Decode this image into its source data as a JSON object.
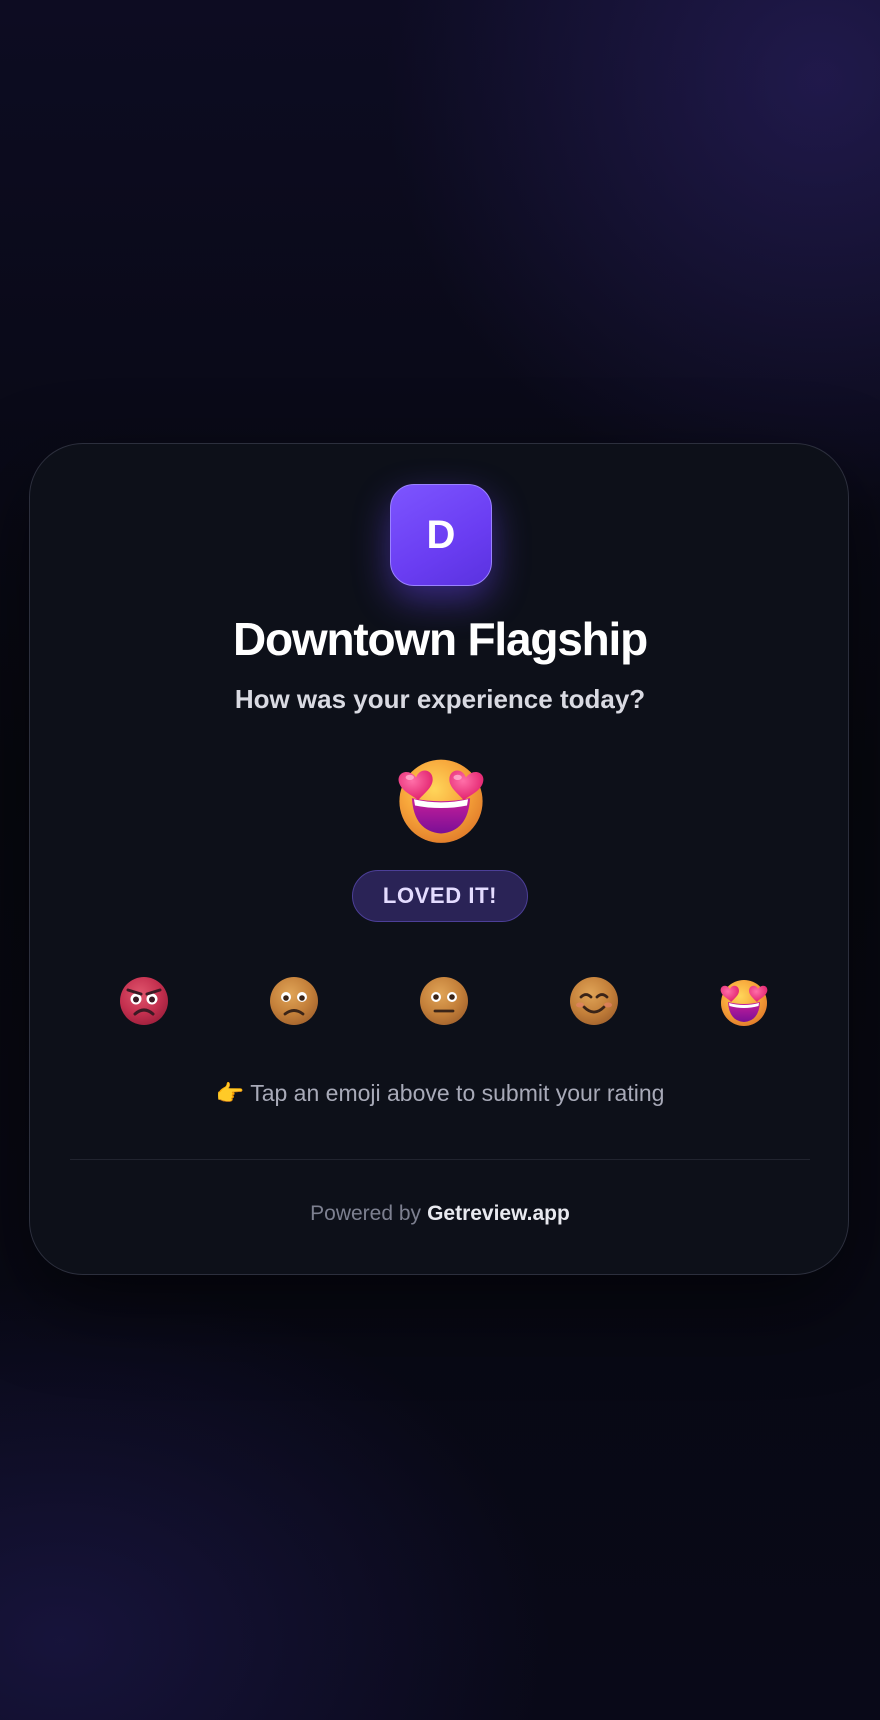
{
  "business": {
    "initial": "D",
    "name": "Downtown Flagship"
  },
  "prompt": {
    "question": "How was your experience today?"
  },
  "selection": {
    "emoji": "heart-eyes-face",
    "label": "LOVED IT!"
  },
  "rating_options": [
    {
      "emoji": "angry-face",
      "selected": false
    },
    {
      "emoji": "frowning-face",
      "selected": false
    },
    {
      "emoji": "neutral-face",
      "selected": false
    },
    {
      "emoji": "smiling-face",
      "selected": false
    },
    {
      "emoji": "heart-eyes-face",
      "selected": true
    }
  ],
  "hint": {
    "icon": "👉",
    "text": "Tap an emoji above to submit your rating"
  },
  "footer": {
    "prefix": "Powered by",
    "link_text": "Getreview.app"
  },
  "colors": {
    "accent": "#6e46f5",
    "pill_background": "#2a2356",
    "card_background": "#0d1019",
    "page_background": "#07080f"
  }
}
